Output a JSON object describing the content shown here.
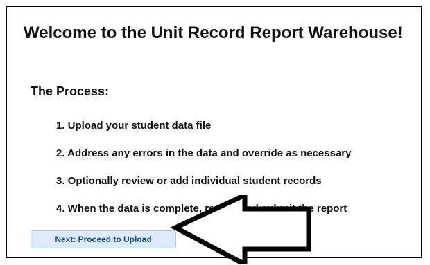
{
  "welcome": {
    "title": "Welcome to the Unit Record Report Warehouse!",
    "subtitle": "The Process:",
    "steps": [
      "1. Upload your student data file",
      "2. Address any errors in the data and override as necessary",
      "3. Optionally review or add individual student records",
      "4. When the data is complete, review and submit the report"
    ],
    "next_button_label": "Next: Proceed to Upload"
  },
  "arrow_icon": "left-arrow-icon"
}
